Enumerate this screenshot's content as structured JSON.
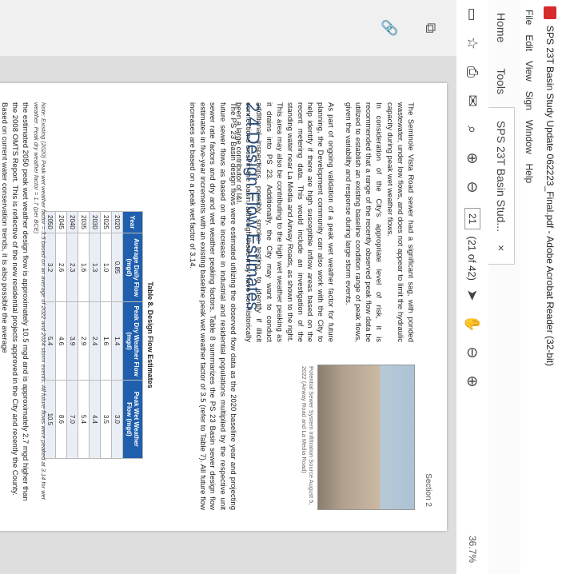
{
  "window": {
    "title": "SPS 23T Basin Study Update 062223_Final.pdf - Adobe Acrobat Reader (32-bit)"
  },
  "menu": [
    "File",
    "Edit",
    "View",
    "Sign",
    "Window",
    "Help"
  ],
  "tabs": {
    "home": "Home",
    "tools": "Tools",
    "document": "SPS 23T Basin Stud..."
  },
  "toolbar": {
    "page_current": "21",
    "page_total": "(21 of 42)",
    "zoom": "36.7%"
  },
  "doc": {
    "section": "Section 2",
    "bullet": "The Seminole Vista Road sewer had a significant sag, with ponded wastewater, under low flows, and does not appear to limit the hydraulic capacity during peak wet weather flows.",
    "para1": "In consideration of the City's appropriate level of risk, it is recommended that a range of the recently observed peak flow data be utilized to establish an existing baseline condition range of peak flows, given the variability and response during large storm events.",
    "para2": "As part of ongoing validation of a peak wet weather factor for future planning, the Development community can also work with the City to help identify if there are high susceptible inflow areas based on the recent metering data. This would include an investigation of the standing water near La Media and Airway Roads, as shown to the right. This area may also be contributing to the high wet weather peaking as it drains into PS 23. Additionally, the City may want to conduct additional inspections, possibly smoke testing, to identify if illicit connections exist in the basin, although these may have not historically been a large contributor of I&I.",
    "photo_caption": "Potential Sewer System Infiltration Source August 5, 2022 (Airway Road and La Media Road)",
    "heading": "2.4 Design Flow Estimates",
    "para3": "The PS 23 Basin design flows were estimated utilizing the observed flow data as the 2020 baseline year and projecting future sewer flows as based on the increase in industrial and residential populations multiplied by the respective unit sewer rate factors and dry and wet weather peaking factors. Table 8 summarizes the PS 23 Basin sewer design flow estimates in five-year increments with an existing baseline peak wet weather factor of 3.5 (refer to Table 7). All future flow increases are based on a peak wet factor of 3.14.",
    "table_title": "Table 8. Design Flow Estimates",
    "table_headers": [
      "Year",
      "Average Daily Flow (mgd)",
      "Peak Dry Weather Flow (mgd)",
      "Peak Wet Weather Flow (mgd)"
    ],
    "table_rows": [
      [
        "2020",
        "0.85",
        "1.4",
        "3.0"
      ],
      [
        "2025",
        "1.0",
        "1.6",
        "3.5"
      ],
      [
        "2030",
        "1.3",
        "2.4",
        "4.4"
      ],
      [
        "2035",
        "1.6",
        "2.9",
        "5.4"
      ],
      [
        "2040",
        "2.3",
        "3.9",
        "7.0"
      ],
      [
        "2045",
        "2.6",
        "4.6",
        "8.6"
      ],
      [
        "2050",
        "3.2",
        "5.4",
        "10.5"
      ]
    ],
    "note": "Note: Existing (2020) Peak wet weather factor = 3.5 based on an average of 2022 and 2024 storm events. All future flows were peaked at 3.14 for wet weather. Peak dry weather factor = 1.7 (per BCE)",
    "para4": "the estimated 2050 peak wet weather design flow is approximately 10.5 mgd and is approximately 2.7 mgd higher than the 2008 OMTS Report. This is reflective of the new residential projects approved in the City and recently the County. Based on current water conservation trends, it is also possible the average"
  }
}
